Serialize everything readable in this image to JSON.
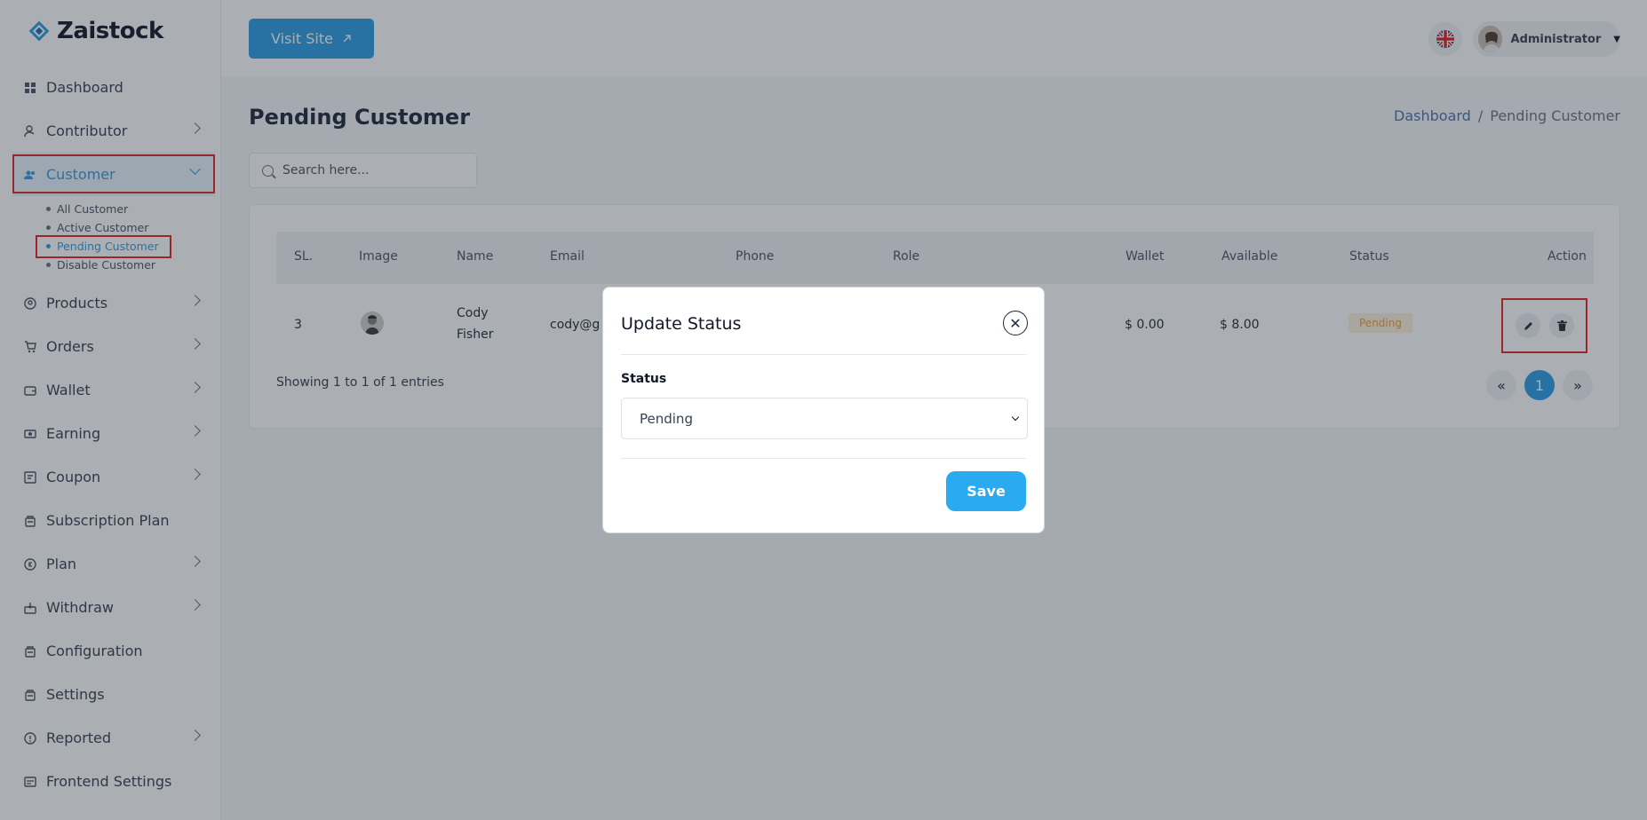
{
  "app": {
    "logo_text": "Zaistock"
  },
  "sidebar": {
    "items": [
      {
        "label": "Dashboard",
        "icon": "dashboard-icon",
        "has_children": false
      },
      {
        "label": "Contributor",
        "icon": "contributor-icon",
        "has_children": true
      },
      {
        "label": "Customer",
        "icon": "customer-icon",
        "has_children": true,
        "expanded": true
      },
      {
        "label": "Products",
        "icon": "products-icon",
        "has_children": true
      },
      {
        "label": "Orders",
        "icon": "cart-icon",
        "has_children": true
      },
      {
        "label": "Wallet",
        "icon": "wallet-icon",
        "has_children": true
      },
      {
        "label": "Earning",
        "icon": "earning-icon",
        "has_children": true
      },
      {
        "label": "Coupon",
        "icon": "coupon-icon",
        "has_children": true
      },
      {
        "label": "Subscription Plan",
        "icon": "subscription-icon",
        "has_children": false
      },
      {
        "label": "Plan",
        "icon": "plan-icon",
        "has_children": true
      },
      {
        "label": "Withdraw",
        "icon": "withdraw-icon",
        "has_children": true
      },
      {
        "label": "Configuration",
        "icon": "configuration-icon",
        "has_children": false
      },
      {
        "label": "Settings",
        "icon": "settings-icon",
        "has_children": false
      },
      {
        "label": "Reported",
        "icon": "reported-icon",
        "has_children": true
      },
      {
        "label": "Frontend Settings",
        "icon": "frontend-settings-icon",
        "has_children": false
      }
    ],
    "customer_sub": [
      {
        "label": "All Customer"
      },
      {
        "label": "Active Customer"
      },
      {
        "label": "Pending Customer",
        "active": true
      },
      {
        "label": "Disable Customer"
      }
    ]
  },
  "header": {
    "visit_site": "Visit Site",
    "user_name": "Administrator"
  },
  "page": {
    "title": "Pending Customer",
    "breadcrumb": [
      "Dashboard",
      "/",
      "Pending Customer"
    ],
    "search_placeholder": "Search here..."
  },
  "table": {
    "columns": [
      "SL.",
      "Image",
      "Name",
      "Email",
      "Phone",
      "Role",
      "Wallet",
      "Available",
      "Status",
      "Action"
    ],
    "rows": [
      {
        "sl": "3",
        "name_line1": "Cody",
        "name_line2": "Fisher",
        "email": "cody@g",
        "wallet": "$ 0.00",
        "available": "$ 8.00",
        "status": "Pending"
      }
    ],
    "showing": "Showing 1 to 1 of 1 entries",
    "pagination": {
      "prev": "«",
      "current": "1",
      "next": "»"
    }
  },
  "modal": {
    "title": "Update Status",
    "field_label": "Status",
    "selected": "Pending",
    "save": "Save"
  },
  "colors": {
    "accent": "#2a9fe6",
    "highlight": "#e02424",
    "pending": "#f0a030"
  }
}
